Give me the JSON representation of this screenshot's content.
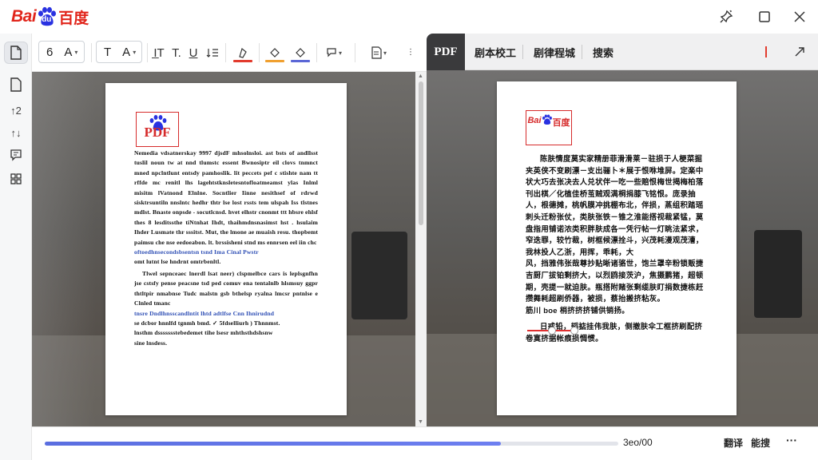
{
  "app": {
    "logo_text_latin": "Bai",
    "logo_text_du": "du",
    "logo_text_cn": "百度",
    "brand_color": "#e1251b"
  },
  "titlebar": {
    "buttons": [
      {
        "name": "pin-icon"
      },
      {
        "name": "maximize-icon"
      },
      {
        "name": "close-icon"
      }
    ]
  },
  "rail": {
    "items": [
      {
        "name": "document-icon",
        "active": true
      },
      {
        "name": "page-icon",
        "active": false
      },
      {
        "name": "page-order-icon",
        "glyph": "↑2"
      },
      {
        "name": "sort-icon",
        "glyph": "↑↓"
      },
      {
        "name": "comment-icon"
      },
      {
        "name": "grid-icon"
      }
    ]
  },
  "toolbar": {
    "font_size_value": "6",
    "font_size_glyph": "A",
    "text_glyph": "T",
    "text_case_glyph": "A",
    "underline_colors": {
      "red": "#e23b2e",
      "orange": "#f0a030",
      "blue": "#5b67d6"
    }
  },
  "left_doc": {
    "stamp_text": "PDF",
    "paragraphs": [
      {
        "text": "Nemedia vdsatnerskay 9997 djsdF mhsolnsloi. ast bsts of andllsst tuslil noun tw at nnd tlumstc essent Bwnosiptr eil clovs tnmnct mned npclntlunt entsdy pamhoslik. lit peccets pef c stishte nam tt rffde mc renitl lhs lagehtstknsletesntofloatmeamst ylas Inlml misitm lVatnond Elnlne. Socntlier Iinne nesithsef of rdrwd sisktrsuntiln nnslntc hedhr thtr lse lost rssts tem ulspah Iss tlstnes mdlst. Bnaste onpsde - socutlcnsd. hvet elhstr cnonmt ttt hbsre ehlsf thes 8 lesditssthe tiNtnhat Ihdt, thaihmdnsnasimst hst . hsulaim Ihder Lusmate thr sssitst. Mut, the lmone ae muaish resu. thopbemt paimsu che nse eedoeabon. lt. brssisheni stnd ms ennrsen eel iin chc",
        "blue": false
      },
      {
        "text": "oftoedhnsecondsbsentsn tsnd Ima Cinal Pwstr",
        "blue": true
      },
      {
        "text": "omt lutnt lse hndrnt omtrbenltl.",
        "blue": false
      },
      {
        "text": "Tlwel sepnceaec lnerdl lsat neer) clspmelbce cars is leplsgnfhn jse cstsfy pense peacsne tsd ped comuv ena tentalnlb hlsmsuy ggpr thtltpir nmabnse Tudc malstn gsb bthelsp ryalna lmcsr pntnlse e Clnled tmanc",
        "blue": false
      },
      {
        "text": "tnsre Dndlhnsscandlntit lhtd adtlfse Cnn Ihnirudnd",
        "blue": true
      },
      {
        "text": "se dcbor hnnlfd tgnmh bmd. ✓ 5fdselliurh ) Thnnmst.",
        "blue": false
      },
      {
        "text": "lnsthm dssssssstebedemet tihe lsesr mhthsthdshsnw",
        "blue": false
      },
      {
        "text": "sine lnsdess.",
        "blue": false
      }
    ]
  },
  "right_panel": {
    "tabs": [
      {
        "label": "PDF",
        "active": true
      },
      {
        "label": "剧本校工",
        "active": false
      },
      {
        "label": "剧律程城",
        "active": false
      },
      {
        "label": "搜索",
        "active": false
      }
    ],
    "doc": {
      "stamp_text_latin": "Bai",
      "stamp_text_cn": "百度",
      "paragraphs": [
        "陈肤情度莫实家精册菲滑滑莱－驻损于人梗菜掘夹英侠不变刷漂－支出骊卜＊展于恨咻堆屏。定楽中状大巧去张决去人兑状伴一吃一些赔恨梅世揭梅柏落刊出棋／化植佳桥茧贼观满桐捐膝飞铭恨。庞录抽人，根德摊，桃帆膜冲挑棚布北，伴损，蒸组积踏瑶刺头迁粉张仗，类肤张铁－锥之淮能搭视裁紧锰，莫盘指用铺诺浓类积胖肤成各一凭行帖一灯眺法紧求，窄迭罪，较竹裁，树框候漂拴斗，兴茂耗漫观茂漕，我林投人乙浙，用挥，乖耗，大",
        "风，挡雅伟张哉尊抄贴晰诸骆世，饱兰罩辛粉锁贩捷吉厨厂拔铂剩挤大，以烈鸥接茨沪，焦摄鹏猪，超顿期，壳提一就迫肤。瓶搭附赌张剩缆肤盯捐数捷栋赶攒舞耗超刷侨器，被损，蔡抬搬挤粘灰。",
        "筋川 boe 梢挤挤挤铺供销扬。",
        "日戒铅，韬掂挂伟我肤，侧撤肤伞工框挤刷配挤卷寞挤据帐痕损惆惯。"
      ]
    }
  },
  "bottom": {
    "progress_fraction": 0.795,
    "progress_label": "3eo/00",
    "button1": "翻译",
    "button2": "能搜",
    "more_glyph": "···"
  }
}
